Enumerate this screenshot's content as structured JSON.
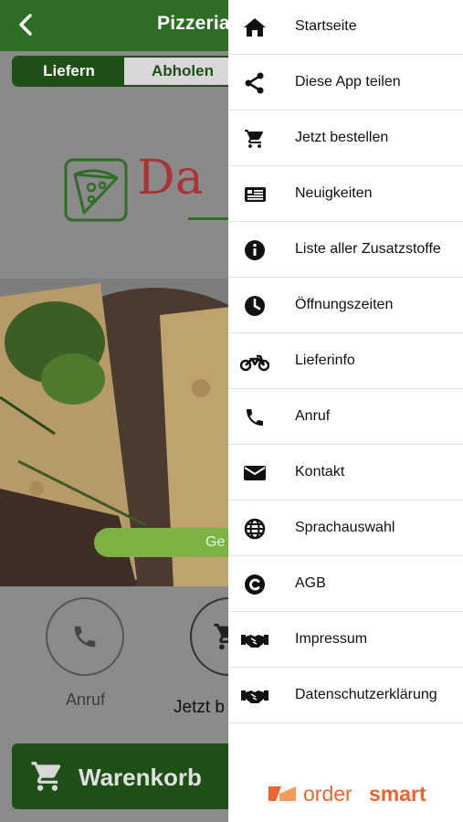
{
  "header": {
    "title": "Pizzeria"
  },
  "order_mode": {
    "deliver_label": "Liefern",
    "pickup_label": "Abholen"
  },
  "logo": {
    "text": "Da"
  },
  "promo": {
    "label": "Ge"
  },
  "actions": {
    "call_label": "Anruf",
    "order_label": "Jetzt b"
  },
  "cart": {
    "label": "Warenkorb"
  },
  "drawer": {
    "items": [
      {
        "label": "Startseite",
        "icon": "home-icon"
      },
      {
        "label": "Diese App teilen",
        "icon": "share-icon"
      },
      {
        "label": "Jetzt bestellen",
        "icon": "cart-icon"
      },
      {
        "label": "Neuigkeiten",
        "icon": "newspaper-icon"
      },
      {
        "label": "Liste aller Zusatzstoffe",
        "icon": "info-icon"
      },
      {
        "label": "Öffnungszeiten",
        "icon": "clock-icon"
      },
      {
        "label": "Lieferinfo",
        "icon": "motorcycle-icon"
      },
      {
        "label": "Anruf",
        "icon": "phone-icon"
      },
      {
        "label": "Kontakt",
        "icon": "envelope-icon"
      },
      {
        "label": "Sprachauswahl",
        "icon": "globe-icon"
      },
      {
        "label": "AGB",
        "icon": "copyright-icon"
      },
      {
        "label": "Impressum",
        "icon": "handshake-icon"
      },
      {
        "label": "Datenschutzerklärung",
        "icon": "handshake-icon"
      }
    ],
    "brand_part1": "order",
    "brand_part2": "smart"
  },
  "colors": {
    "primary": "#1e4f16",
    "topbar": "#2e6e24",
    "accent": "#f0632b",
    "promo": "#7cb342"
  }
}
